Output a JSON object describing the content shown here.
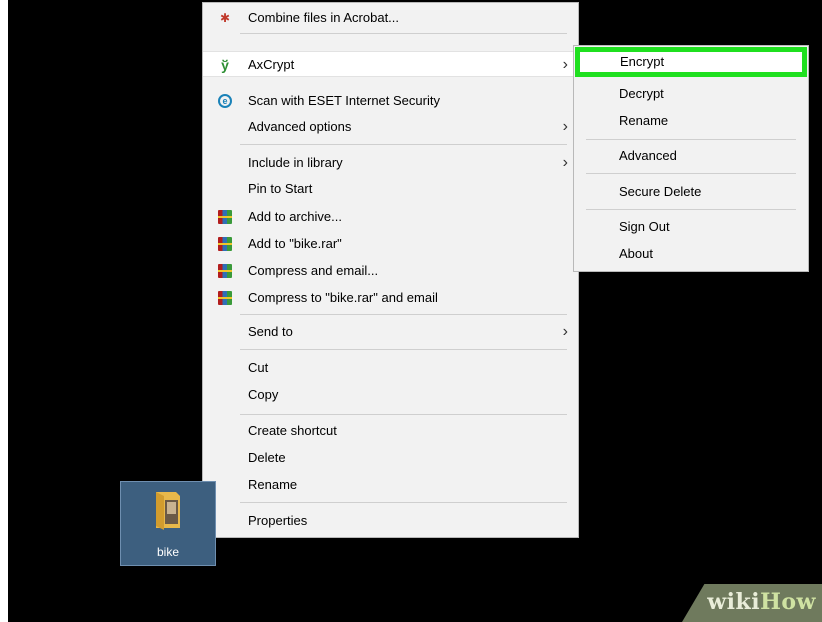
{
  "context_menu": {
    "items": [
      {
        "label": "Combine files in Acrobat...",
        "icon": "acrobat-icon"
      },
      {
        "label": "AxCrypt",
        "icon": "axcrypt-icon",
        "has_submenu": true
      },
      {
        "label": "Scan with ESET Internet Security",
        "icon": "eset-icon"
      },
      {
        "label": "Advanced options",
        "has_submenu": true
      },
      {
        "label": "Include in library",
        "has_submenu": true
      },
      {
        "label": "Pin to Start"
      },
      {
        "label": "Add to archive...",
        "icon": "winrar-icon"
      },
      {
        "label": "Add to \"bike.rar\"",
        "icon": "winrar-icon"
      },
      {
        "label": "Compress and email...",
        "icon": "winrar-icon"
      },
      {
        "label": "Compress to \"bike.rar\" and email",
        "icon": "winrar-icon"
      },
      {
        "label": "Send to",
        "has_submenu": true
      },
      {
        "label": "Cut"
      },
      {
        "label": "Copy"
      },
      {
        "label": "Create shortcut"
      },
      {
        "label": "Delete"
      },
      {
        "label": "Rename"
      },
      {
        "label": "Properties"
      }
    ],
    "arrow_glyph": "›"
  },
  "axcrypt_submenu": {
    "items": [
      {
        "label": "Encrypt",
        "highlighted": true
      },
      {
        "label": "Decrypt"
      },
      {
        "label": "Rename"
      },
      {
        "label": "Advanced"
      },
      {
        "label": "Secure Delete"
      },
      {
        "label": "Sign Out"
      },
      {
        "label": "About"
      }
    ],
    "highlight_color": "#1fe01f"
  },
  "desktop": {
    "selected_item": {
      "name": "bike",
      "icon": "folder-icon"
    },
    "background_color": "#000000"
  },
  "watermark": {
    "part1": "wiki",
    "part2": "How"
  }
}
